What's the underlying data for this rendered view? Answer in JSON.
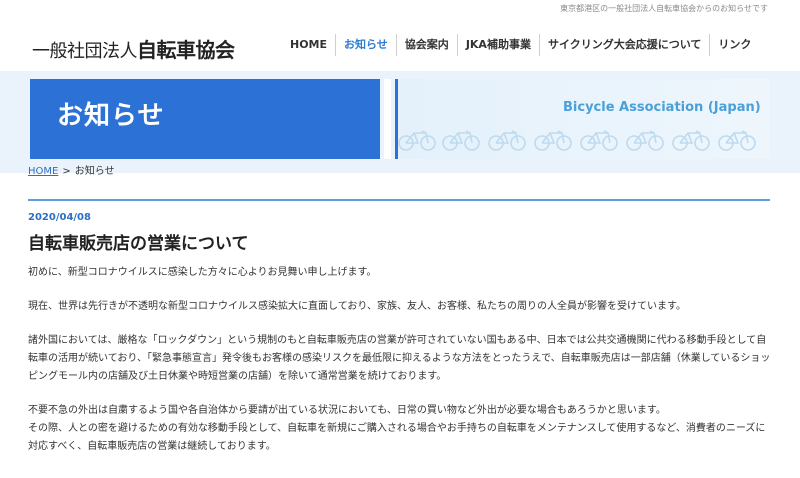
{
  "header": {
    "top_note": "東京都港区の一般社団法人自転車協会からのお知らせです",
    "logo_prefix": "一般社団法人",
    "logo_name": "自転車協会"
  },
  "nav": {
    "items": [
      {
        "label": "HOME",
        "active": false
      },
      {
        "label": "お知らせ",
        "active": true
      },
      {
        "label": "協会案内",
        "active": false
      },
      {
        "label": "JKA補助事業",
        "active": false
      },
      {
        "label": "サイクリング大会応援について",
        "active": false
      },
      {
        "label": "リンク",
        "active": false
      }
    ],
    "active_color": "#2c7cd1"
  },
  "banner": {
    "title": "お知らせ",
    "subtitle_en": "Bicycle Association (Japan)",
    "primary_color": "#2b71d6"
  },
  "breadcrumb": {
    "home": "HOME",
    "separator": ">",
    "current": "お知らせ"
  },
  "post": {
    "date": "2020/04/08",
    "title": "自転車販売店の営業について",
    "paragraphs": [
      "初めに、新型コロナウイルスに感染した方々に心よりお見舞い申し上げます。",
      "現在、世界は先行きが不透明な新型コロナウイルス感染拡大に直面しており、家族、友人、お客様、私たちの周りの人全員が影響を受けています。",
      "諸外国においては、厳格な「ロックダウン」という規制のもと自転車販売店の営業が許可されていない国もある中、日本では公共交通機関に代わる移動手段として自転車の活用が続いており、「緊急事態宣言」発令後もお客様の感染リスクを最低限に抑えるような方法をとったうえで、自転車販売店は一部店舗（休業しているショッピングモール内の店舗及び土日休業や時短営業の店舗）を除いて通常営業を続けております。",
      "不要不急の外出は自粛するよう国や各自治体から要請が出ている状況においても、日常の買い物など外出が必要な場合もあろうかと思います。\nその際、人との密を避けるための有効な移動手段として、自転車を新規にご購入される場合やお手持ちの自転車をメンテナンスして使用するなど、消費者のニーズに対応すべく、自転車販売店の営業は継続しております。"
    ]
  }
}
